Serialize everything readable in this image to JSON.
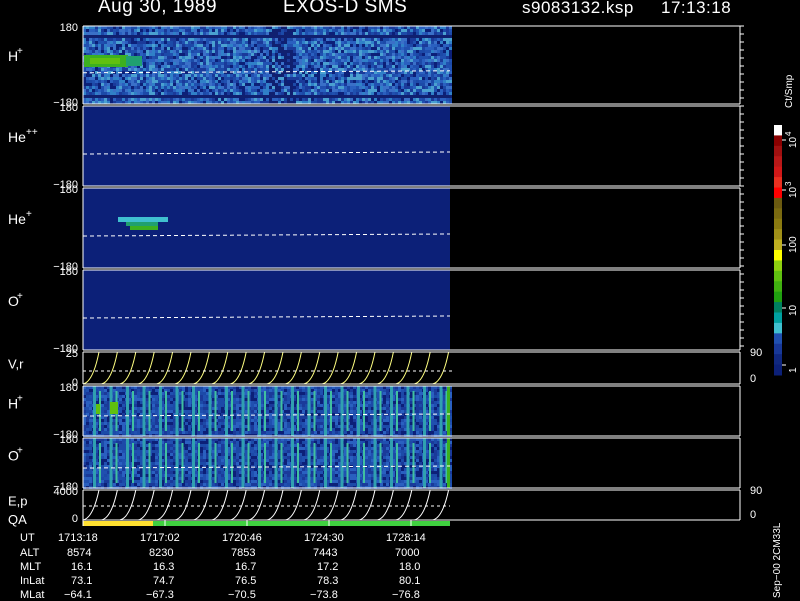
{
  "header": {
    "date": "Aug 30, 1989",
    "instrument": "EXOS-D SMS",
    "file": "s9083132.ksp",
    "time": "17:13:18"
  },
  "panels": [
    {
      "id": "h_plus",
      "species": "H",
      "charge": "+",
      "ymax": "180",
      "ymin": "−180"
    },
    {
      "id": "he_pp",
      "species": "He",
      "charge": "++",
      "ymax": "180",
      "ymin": "−180"
    },
    {
      "id": "he_plus",
      "species": "He",
      "charge": "+",
      "ymax": "180",
      "ymin": "−180"
    },
    {
      "id": "o_plus",
      "species": "O",
      "charge": "+",
      "ymax": "180",
      "ymin": "−180"
    },
    {
      "id": "vr",
      "label": "V,r",
      "ymax": "25",
      "ymin": "0",
      "right_top": "90",
      "right_bot": "0"
    },
    {
      "id": "h_plus2",
      "species": "H",
      "charge": "+",
      "ymax": "180",
      "ymin": "−180"
    },
    {
      "id": "o_plus2",
      "species": "O",
      "charge": "+",
      "ymax": "180",
      "ymin": "−180"
    },
    {
      "id": "ep",
      "label": "E,p",
      "ymax": "4000",
      "ymin": "0",
      "right_top": "90",
      "right_bot": "0"
    }
  ],
  "qa_label": "QA",
  "colorbar": {
    "unit": "Ct/Smp",
    "ticks": [
      {
        "base": "10",
        "exp": "4"
      },
      {
        "base": "10",
        "exp": "3"
      },
      {
        "base": "100",
        "exp": ""
      },
      {
        "base": "10",
        "exp": ""
      },
      {
        "base": "1",
        "exp": ""
      }
    ],
    "colors": [
      "#ffffff",
      "#8b0000",
      "#a01010",
      "#b81818",
      "#d01818",
      "#e83020",
      "#ff0000",
      "#6b5a10",
      "#7a6a10",
      "#8a7a10",
      "#a09018",
      "#c0b020",
      "#ffff00",
      "#8fd010",
      "#60c010",
      "#40b010",
      "#20a010",
      "#008060",
      "#00a0a0",
      "#40c0d0",
      "#2050b0",
      "#183898",
      "#102880",
      "#0c2078"
    ]
  },
  "time_axis": {
    "rows": [
      {
        "label": "UT",
        "values": [
          "1713:18",
          "1717:02",
          "1720:46",
          "1724:30",
          "1728:14"
        ]
      },
      {
        "label": "ALT",
        "values": [
          "8574",
          "8230",
          "7853",
          "7443",
          "7000"
        ]
      },
      {
        "label": "MLT",
        "values": [
          "16.1",
          "16.3",
          "16.7",
          "17.2",
          "18.0"
        ]
      },
      {
        "label": "InLat",
        "values": [
          "73.1",
          "74.7",
          "76.5",
          "78.3",
          "80.1"
        ]
      },
      {
        "label": "MLat",
        "values": [
          "−64.1",
          "−67.3",
          "−70.5",
          "−73.8",
          "−76.8"
        ]
      }
    ]
  },
  "footer_note": "Sep−00 2CM33L",
  "chart_data": {
    "type": "heatmap",
    "title": "Aug 30, 1989   EXOS-D SMS",
    "x_ticks": [
      "1713:18",
      "1717:02",
      "1720:46",
      "1724:30",
      "1728:14"
    ],
    "color_scale": "log",
    "color_range": [
      1,
      10000
    ],
    "colors": {
      "background": "#0c2078",
      "dashed_line": "#ffffff",
      "trace": "#ffff80"
    }
  }
}
